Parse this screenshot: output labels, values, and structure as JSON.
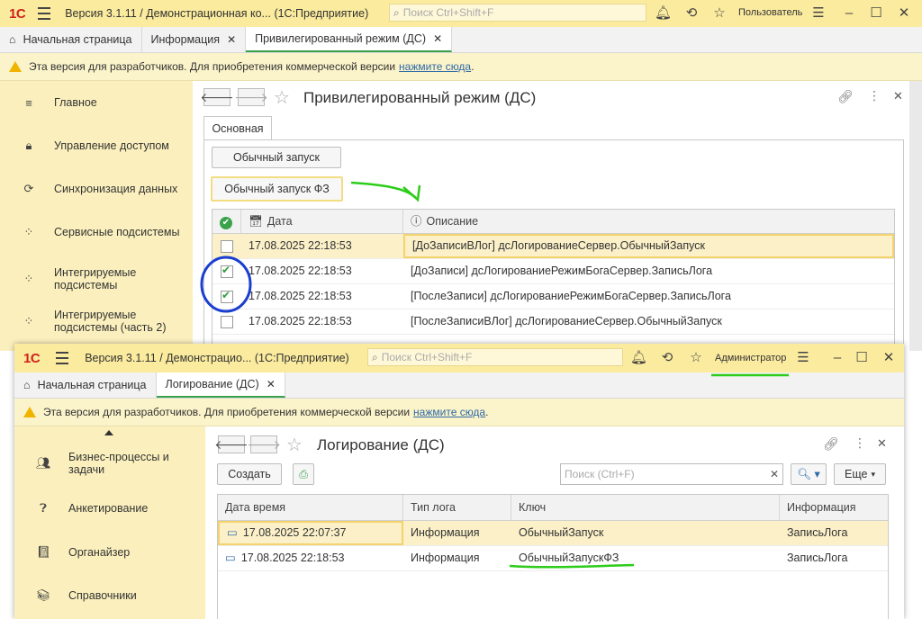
{
  "top_window": {
    "title": "Версия 3.1.11 / Демонстрационная ко...  (1С:Предприятие)",
    "logo": "1С",
    "search_placeholder": "Поиск Ctrl+Shift+F",
    "user": "Пользователь",
    "tabs": [
      {
        "label": "Начальная страница"
      },
      {
        "label": "Информация"
      },
      {
        "label": "Привилегированный режим (ДС)",
        "active": true
      }
    ],
    "warning_text": "Эта версия для разработчиков. Для приобретения коммерческой версии",
    "warning_link": "нажмите сюда",
    "sidebar": [
      {
        "label": "Главное",
        "icon": "menu-icon"
      },
      {
        "label": "Управление доступом",
        "icon": "lock-icon"
      },
      {
        "label": "Синхронизация данных",
        "icon": "sync-icon"
      },
      {
        "label": "Сервисные подсистемы",
        "icon": "grid-icon"
      },
      {
        "label": "Интегрируемые подсистемы",
        "icon": "grid-icon"
      },
      {
        "label": "Интегрируемые подсистемы (часть 2)",
        "icon": "grid-icon"
      }
    ],
    "form": {
      "title": "Привилегированный режим (ДС)",
      "tab": "Основная",
      "btn_normal": "Обычный запуск",
      "btn_fz": "Обычный запуск ФЗ",
      "columns": {
        "date": "Дата",
        "desc": "Описание"
      },
      "rows": [
        {
          "checked": false,
          "date": "17.08.2025 22:18:53",
          "desc": "[ДоЗаписиВЛог] дсЛогированиеСервер.ОбычныйЗапуск"
        },
        {
          "checked": true,
          "date": "17.08.2025 22:18:53",
          "desc": "[ДоЗаписи] дсЛогированиеРежимБогаСервер.ЗаписьЛога"
        },
        {
          "checked": true,
          "date": "17.08.2025 22:18:53",
          "desc": "[ПослеЗаписи] дсЛогированиеРежимБогаСервер.ЗаписьЛога"
        },
        {
          "checked": false,
          "date": "17.08.2025 22:18:53",
          "desc": "[ПослеЗаписиВЛог] дсЛогированиеСервер.ОбычныйЗапуск"
        }
      ]
    }
  },
  "bottom_window": {
    "title": "Версия 3.1.11 / Демонстрацио...  (1С:Предприятие)",
    "logo": "1С",
    "search_placeholder": "Поиск Ctrl+Shift+F",
    "user": "Администратор",
    "tabs": [
      {
        "label": "Начальная страница"
      },
      {
        "label": "Логирование (ДС)",
        "active": true
      }
    ],
    "warning_text": "Эта версия для разработчиков. Для приобретения коммерческой версии",
    "warning_link": "нажмите сюда",
    "sidebar": [
      {
        "label": "Бизнес-процессы и задачи",
        "icon": "users-icon"
      },
      {
        "label": "Анкетирование",
        "icon": "question-icon"
      },
      {
        "label": "Органайзер",
        "icon": "notebook-icon"
      },
      {
        "label": "Справочники",
        "icon": "books-icon"
      }
    ],
    "form": {
      "title": "Логирование (ДС)",
      "btn_create": "Создать",
      "search_placeholder": "Поиск (Ctrl+F)",
      "btn_more": "Еще",
      "columns": {
        "datetime": "Дата время",
        "type": "Тип лога",
        "key": "Ключ",
        "info": "Информация"
      },
      "rows": [
        {
          "datetime": "17.08.2025 22:07:37",
          "type": "Информация",
          "key": "ОбычныйЗапуск",
          "info": "ЗаписьЛога"
        },
        {
          "datetime": "17.08.2025 22:18:53",
          "type": "Информация",
          "key": "ОбычныйЗапускФЗ",
          "info": "ЗаписьЛога"
        }
      ]
    }
  },
  "colors": {
    "accent_green": "#3aa24a",
    "title_bg": "#fbeb9e",
    "sidebar_bg": "#fbf0bd",
    "annotation_green": "#2ecc1a",
    "annotation_blue": "#1a3fd0"
  }
}
